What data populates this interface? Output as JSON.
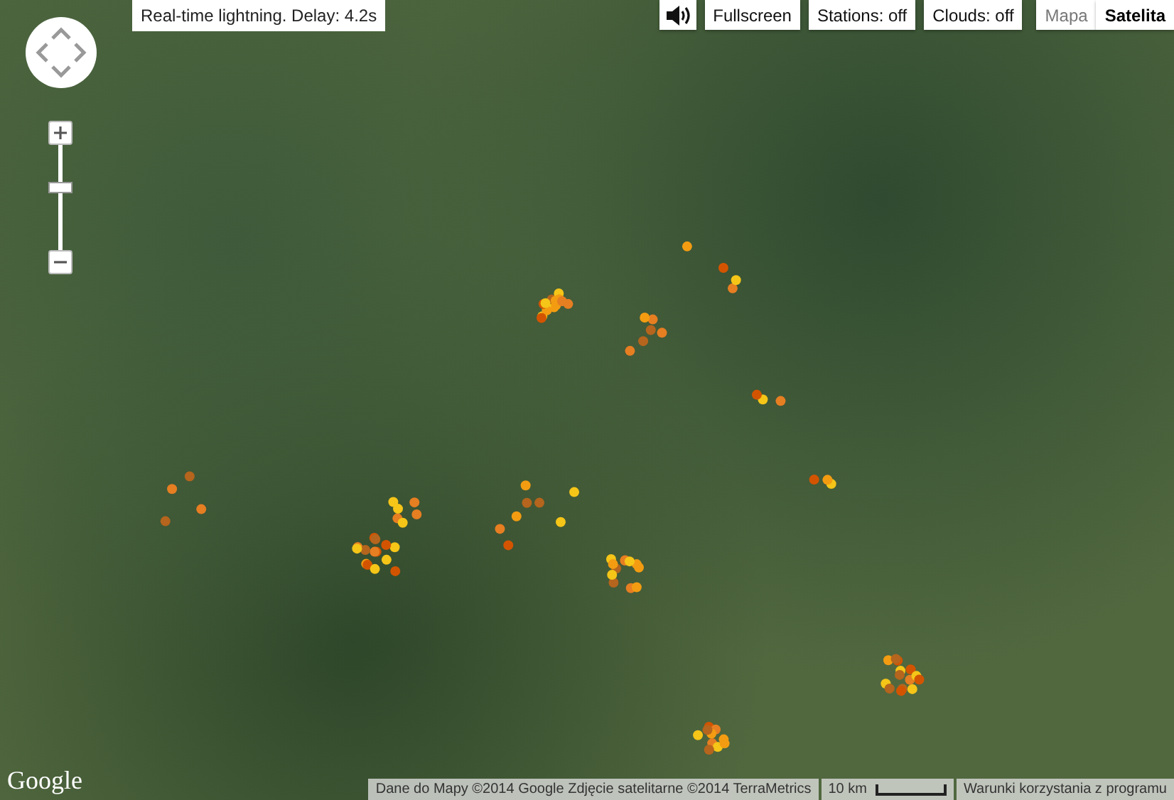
{
  "status": {
    "text": "Real-time lightning. Delay: 4.2s"
  },
  "sound": {
    "on": true
  },
  "toggles": [
    {
      "label": "Fullscreen"
    },
    {
      "label": "Stations: off"
    },
    {
      "label": "Clouds: off"
    }
  ],
  "map_types": [
    {
      "label": "Mapa",
      "selected": false
    },
    {
      "label": "Satelita",
      "selected": true
    }
  ],
  "zoom": {
    "level": 0.6
  },
  "logo": "Google",
  "attribution": "Dane do Mapy ©2014 Google Zdjęcie satelitarne ©2014 TerraMetrics",
  "scale": "10 km",
  "terms": "Warunki korzystania z programu"
}
